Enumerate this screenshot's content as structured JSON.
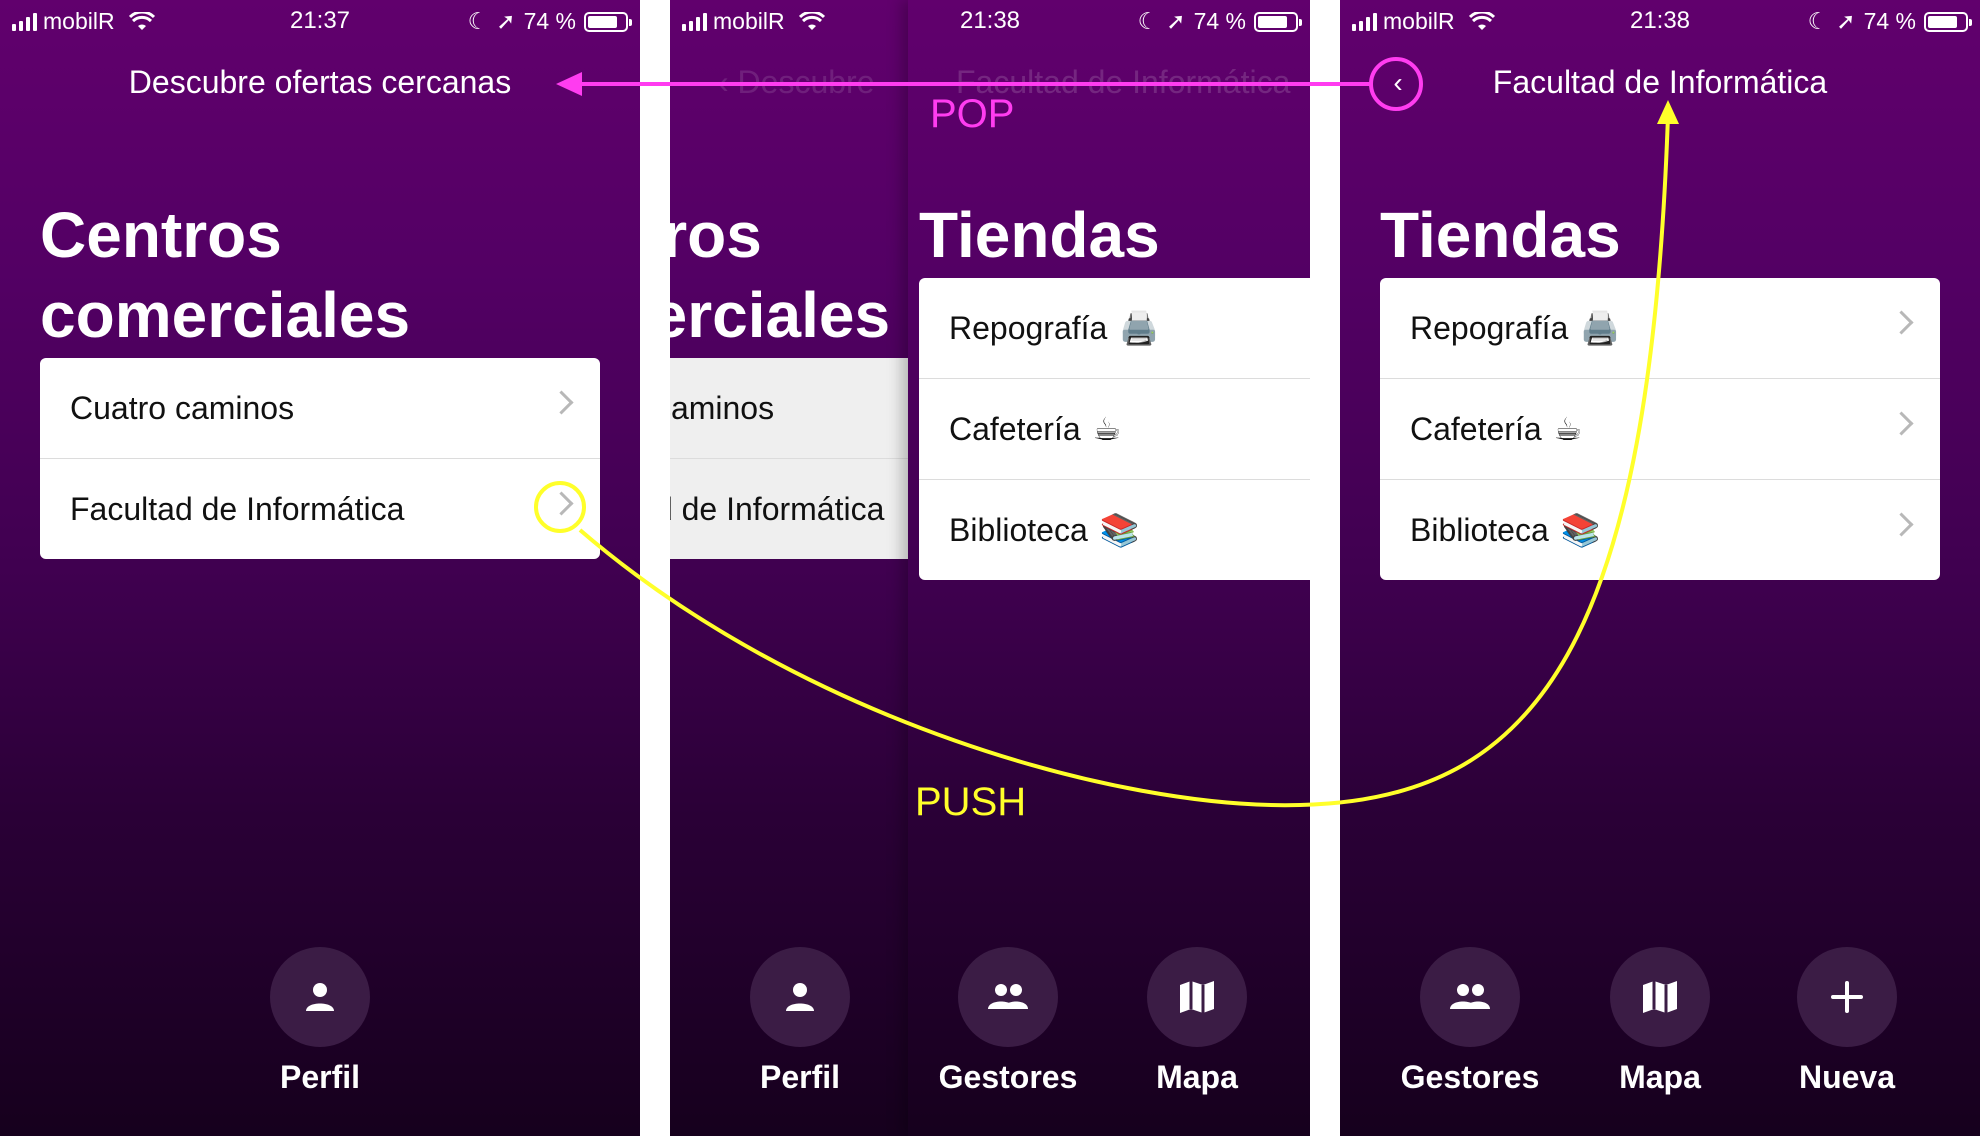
{
  "colors": {
    "pop": "#ff3cf0",
    "push": "#ffff2a",
    "bg_top": "#61006d",
    "bg_bottom": "#16001d"
  },
  "statusbar": [
    {
      "carrier": "mobilR",
      "time": "21:37",
      "battery": "74 %"
    },
    {
      "carrier": "mobilR",
      "time": "21:38",
      "battery": "74 %"
    },
    {
      "carrier": "mobilR",
      "time": "21:38",
      "battery": "74 %"
    }
  ],
  "screen1": {
    "nav_title": "Descubre ofertas cercanas",
    "title_line1": "Centros",
    "title_line2": "comerciales",
    "items": [
      "Cuatro caminos",
      "Facultad de Informática"
    ],
    "tab_label": "Perfil",
    "tab_icon": "person-icon"
  },
  "screen2": {
    "title": "Tiendas",
    "ghost_back": "Descubre",
    "ghost_title": "Facultad de Informática",
    "items": [
      {
        "label": "Repografía",
        "emoji": "🖨️"
      },
      {
        "label": "Cafetería",
        "emoji": "☕"
      },
      {
        "label": "Biblioteca",
        "emoji": "📚"
      }
    ],
    "tabs": [
      {
        "label": "Perfil",
        "icon": "person-icon"
      },
      {
        "label": "Gestores",
        "icon": "people-icon"
      },
      {
        "label": "Mapa",
        "icon": "map-icon"
      }
    ]
  },
  "screen3": {
    "nav_title": "Facultad de Informática",
    "title": "Tiendas",
    "items": [
      {
        "label": "Repografía",
        "emoji": "🖨️"
      },
      {
        "label": "Cafetería",
        "emoji": "☕"
      },
      {
        "label": "Biblioteca",
        "emoji": "📚"
      }
    ],
    "tabs": [
      {
        "label": "Gestores",
        "icon": "people-icon"
      },
      {
        "label": "Mapa",
        "icon": "map-icon"
      },
      {
        "label": "Nueva",
        "icon": "plus-icon"
      }
    ]
  },
  "annotations": {
    "pop": "POP",
    "push": "PUSH"
  }
}
